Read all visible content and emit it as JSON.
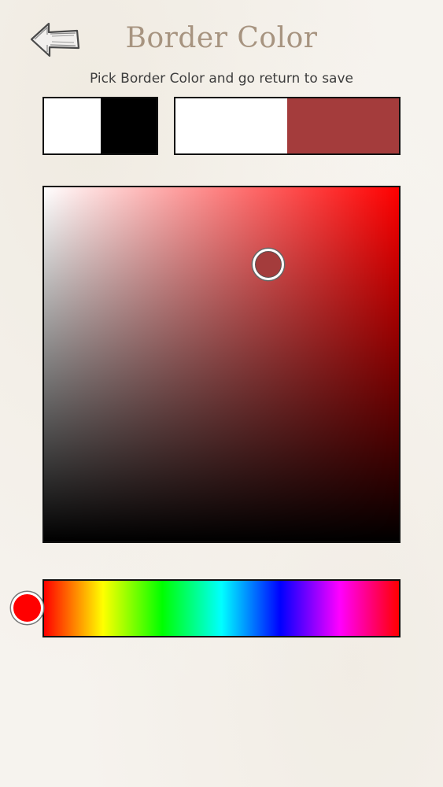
{
  "header": {
    "back_icon": "arrow-left-icon",
    "title": "Border Color",
    "subtitle": "Pick Border Color and go return to save"
  },
  "presets": {
    "white": "#ffffff",
    "black": "#000000"
  },
  "comparison": {
    "previous": "#ffffff",
    "current": "#a43c3c"
  },
  "picker": {
    "hue_color": "#ff0000",
    "selected_color": "#a43c3c",
    "saturation": 0.63,
    "value": 0.64,
    "hue": 0
  }
}
